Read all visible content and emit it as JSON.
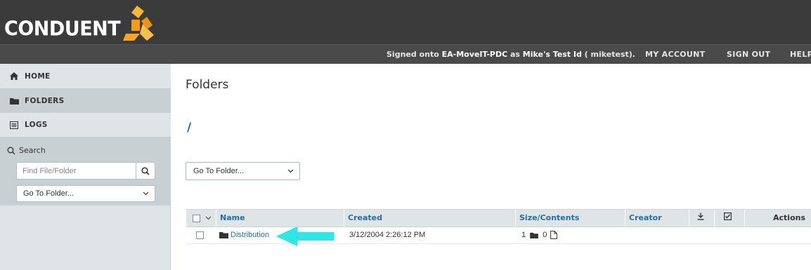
{
  "header": {
    "logo_text": "CONDUENT",
    "signed_prefix": "Signed onto ",
    "server": "EA-MoveIT-PDC",
    "signed_as": " as ",
    "user": "Mike's Test Id",
    "user_suffix": " ( miketest).",
    "nav": {
      "my_account": "MY ACCOUNT",
      "sign_out": "SIGN OUT",
      "help": "HELP"
    }
  },
  "sidebar": {
    "items": [
      {
        "label": "HOME",
        "icon": "home-icon"
      },
      {
        "label": "FOLDERS",
        "icon": "folder-icon"
      },
      {
        "label": "LOGS",
        "icon": "logs-icon"
      }
    ],
    "search": {
      "title": "Search",
      "placeholder": "Find File/Folder",
      "goto_label": "Go To Folder..."
    }
  },
  "main": {
    "title": "Folders",
    "path": "/",
    "goto_label": "Go To Folder...",
    "table": {
      "columns": [
        "Name",
        "Created",
        "Size/Contents",
        "Creator",
        "Actions"
      ],
      "rows": [
        {
          "name": "Distribution",
          "created": "3/12/2004 2:26:12 PM",
          "folders": "1",
          "files": "0"
        }
      ]
    }
  },
  "colors": {
    "header_bg": "#3b3b3b",
    "topbar_bg": "#4a4a4a",
    "sidebar_bg": "#dfe4e6",
    "link": "#1f6fa7",
    "logo_orange": "#f5a623",
    "annotation_arrow": "#2ee6e6"
  }
}
